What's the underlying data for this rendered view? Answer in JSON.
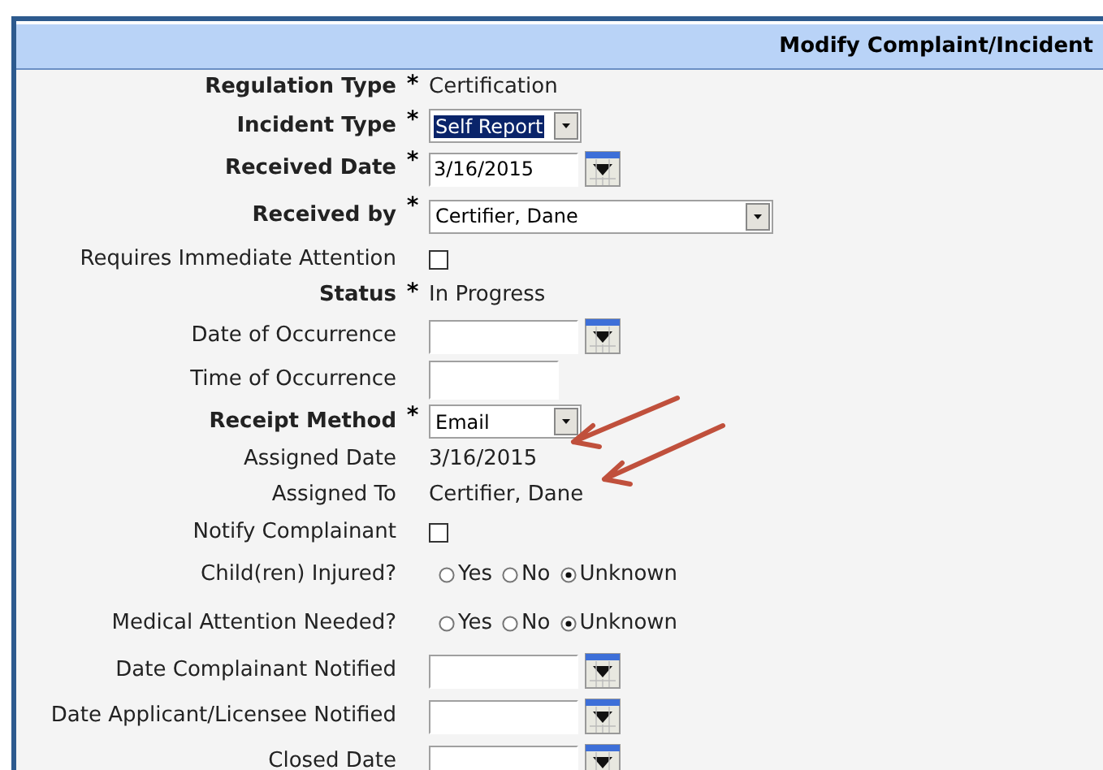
{
  "header": {
    "title": "Modify Complaint/Incident"
  },
  "rows": [
    {
      "kind": "text",
      "label": "Regulation Type",
      "bold": true,
      "required": "*",
      "value": "Certification"
    },
    {
      "kind": "select",
      "label": "Incident Type",
      "bold": true,
      "required": "*",
      "value": "Self Report",
      "highlighted": true
    },
    {
      "kind": "date",
      "label": "Received Date",
      "bold": true,
      "required": "*",
      "value": "3/16/2015"
    },
    {
      "kind": "combobox",
      "label": "Received by",
      "bold": true,
      "required": "*",
      "value": "Certifier, Dane",
      "highlighted": false
    },
    {
      "kind": "checkbox",
      "label": "Requires Immediate Attention",
      "bold": false,
      "checked": false
    },
    {
      "kind": "text",
      "label": "Status",
      "bold": true,
      "required": "*",
      "value": "In Progress"
    },
    {
      "kind": "date",
      "label": "Date of Occurrence",
      "bold": false
    },
    {
      "kind": "textbox",
      "label": "Time of Occurrence",
      "bold": false
    },
    {
      "kind": "select",
      "label": "Receipt Method",
      "bold": true,
      "required": "*",
      "value": "Email",
      "highlighted": false
    },
    {
      "kind": "text",
      "label": "Assigned Date",
      "bold": false,
      "value": "3/16/2015"
    },
    {
      "kind": "text",
      "label": "Assigned To",
      "bold": false,
      "value": "Certifier, Dane"
    },
    {
      "kind": "checkbox",
      "label": "Notify Complainant",
      "bold": false,
      "checked": false
    },
    {
      "kind": "radio",
      "label": "Child(ren) Injured?",
      "bold": false,
      "options": [
        {
          "label": "Yes",
          "selected": false
        },
        {
          "label": "No",
          "selected": false
        },
        {
          "label": "Unknown",
          "selected": true
        }
      ]
    },
    {
      "kind": "radio",
      "label": "Medical Attention Needed?",
      "bold": false,
      "options": [
        {
          "label": "Yes",
          "selected": false
        },
        {
          "label": "No",
          "selected": false
        },
        {
          "label": "Unknown",
          "selected": true
        }
      ]
    },
    {
      "kind": "date",
      "label": "Date Complainant Notified",
      "bold": false
    },
    {
      "kind": "date",
      "label": "Date Applicant/Licensee Notified",
      "bold": false
    },
    {
      "kind": "date",
      "label": "Closed Date",
      "bold": false
    }
  ]
}
